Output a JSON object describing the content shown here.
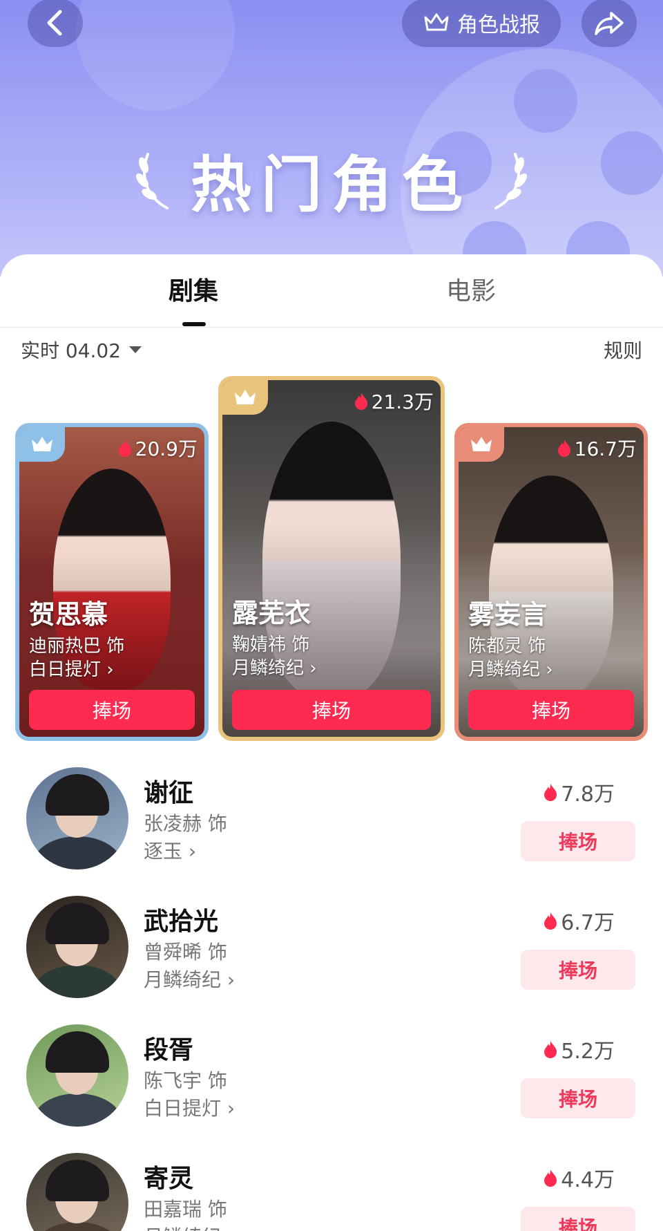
{
  "header": {
    "report_label": "角色战报",
    "title": "热门角色"
  },
  "tabs": [
    {
      "label": "剧集",
      "active": true
    },
    {
      "label": "电影",
      "active": false
    }
  ],
  "filter": {
    "label": "实时 04.02",
    "rules_label": "规则"
  },
  "top_cards": [
    {
      "rank": 2,
      "heat": "20.9万",
      "name": "贺思慕",
      "actor": "迪丽热巴 饰",
      "show": "白日提灯 ›",
      "button": "捧场",
      "crown_color": "#8fc0e8"
    },
    {
      "rank": 1,
      "heat": "21.3万",
      "name": "露芜衣",
      "actor": "鞠婧祎 饰",
      "show": "月鳞绮纪 ›",
      "button": "捧场",
      "crown_color": "#e9c47c"
    },
    {
      "rank": 3,
      "heat": "16.7万",
      "name": "雾妄言",
      "actor": "陈都灵 饰",
      "show": "月鳞绮纪 ›",
      "button": "捧场",
      "crown_color": "#e98c78"
    }
  ],
  "list": [
    {
      "name": "谢征",
      "actor": "张凌赫 饰",
      "show": "逐玉 ›",
      "heat": "7.8万",
      "button": "捧场"
    },
    {
      "name": "武拾光",
      "actor": "曾舜晞 饰",
      "show": "月鳞绮纪 ›",
      "heat": "6.7万",
      "button": "捧场"
    },
    {
      "name": "段胥",
      "actor": "陈飞宇 饰",
      "show": "白日提灯 ›",
      "heat": "5.2万",
      "button": "捧场"
    },
    {
      "name": "寄灵",
      "actor": "田嘉瑞 饰",
      "show": "月鳞绮纪 ›",
      "heat": "4.4万",
      "button": "捧场"
    }
  ],
  "colors": {
    "accent": "#ff2a4f",
    "header_gradient_top": "#8a8ff2",
    "soft_button_bg": "#fde8ec"
  }
}
